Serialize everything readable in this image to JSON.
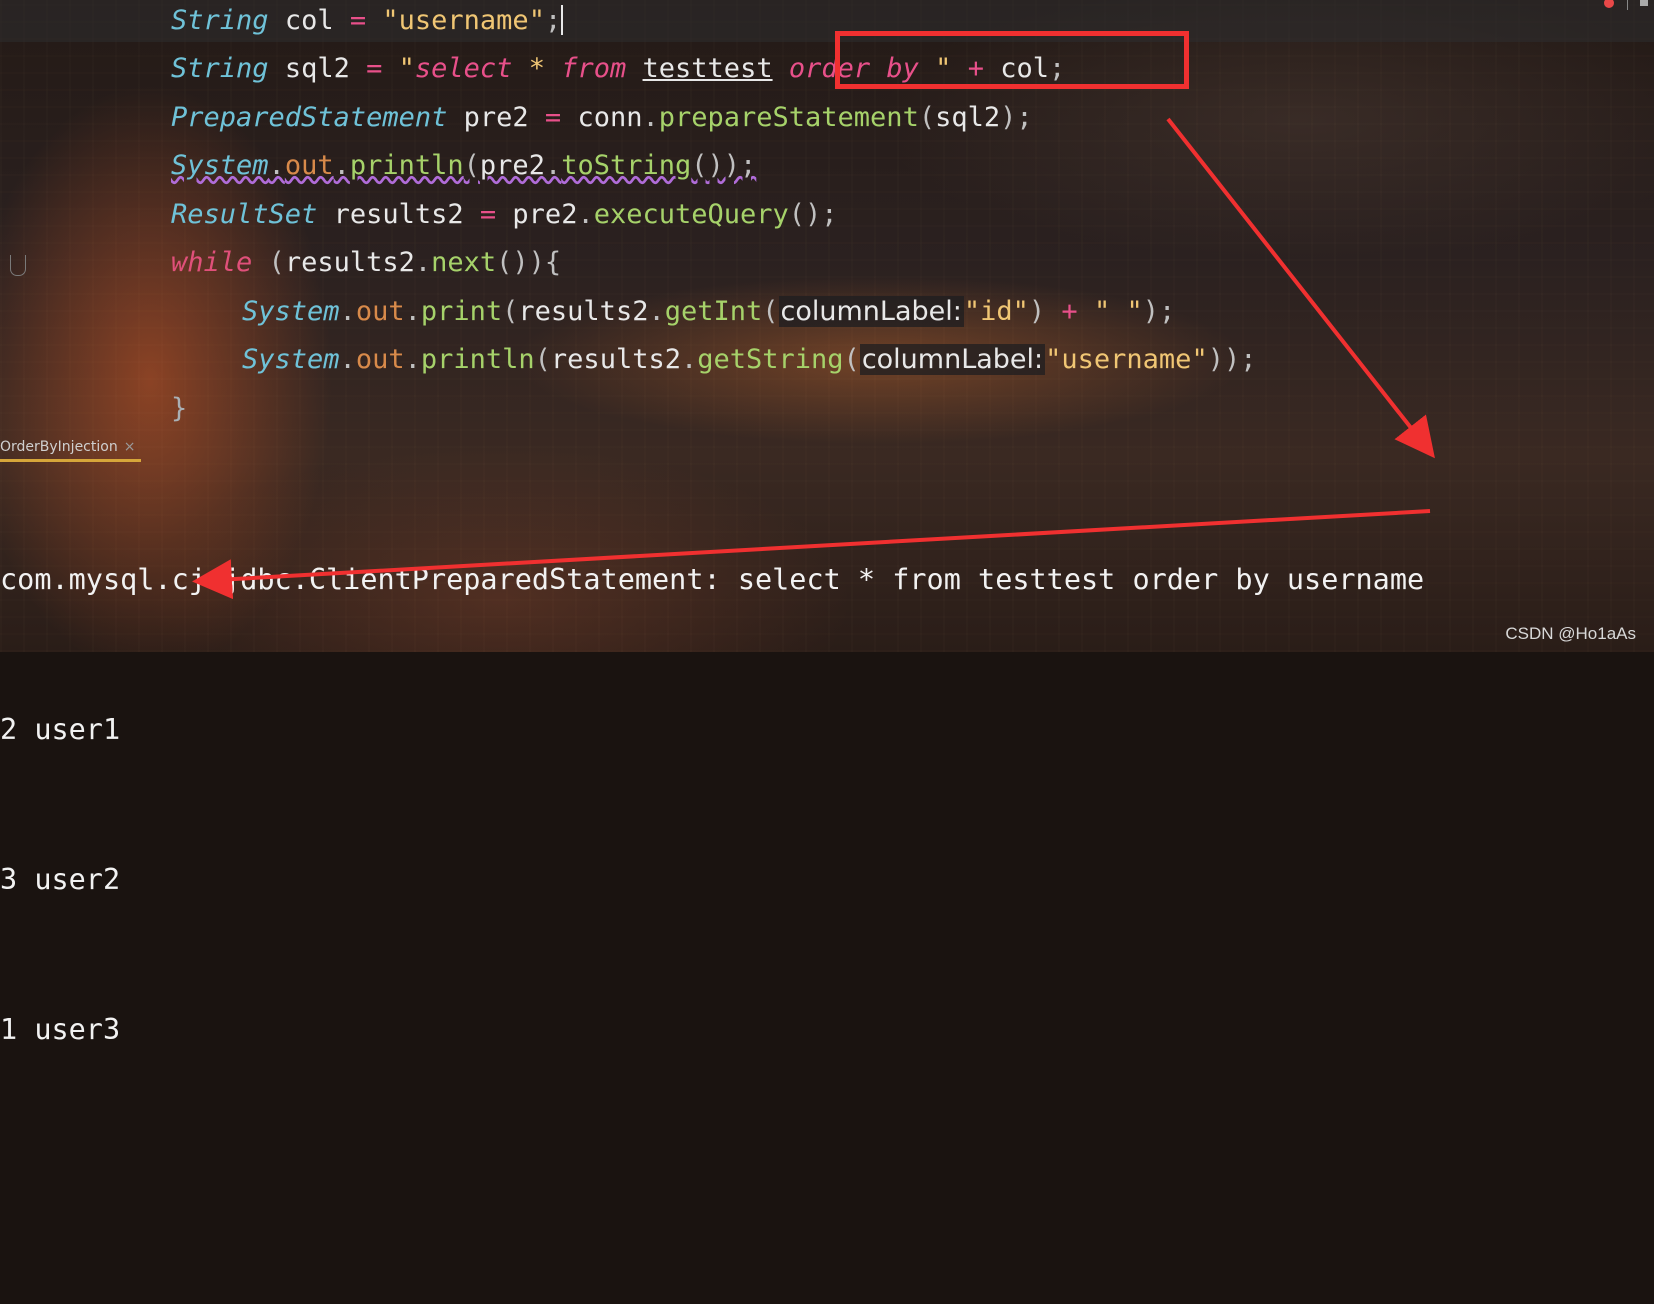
{
  "editor": {
    "line1": {
      "type": "String",
      "var": "col",
      "op": "=",
      "str": "\"username\"",
      "end": ";"
    },
    "line2": {
      "type": "String",
      "var": "sql2",
      "op": "=",
      "str_open": "\"",
      "sql_select": "select",
      "sql_star": " * ",
      "sql_from": "from",
      "sql_table": "testtest",
      "sql_order": "order",
      "sql_by": "by",
      "str_close": "\"",
      "plus": "+",
      "col": "col",
      "end": ";"
    },
    "line3": {
      "type": "PreparedStatement",
      "var": "pre2",
      "op": "=",
      "obj": "conn",
      "method": "prepareStatement",
      "arg": "sql2",
      "end": ");"
    },
    "line4": {
      "cls": "System",
      "field": "out",
      "method": "println",
      "obj": "pre2",
      "inner": "toString",
      "end": "());"
    },
    "line5": {
      "type": "ResultSet",
      "var": "results2",
      "op": "=",
      "obj": "pre2",
      "method": "executeQuery",
      "end": "();"
    },
    "line6": {
      "kw": "while",
      "obj": "results2",
      "method": "next",
      "end": "()){"
    },
    "line7": {
      "cls": "System",
      "field": "out",
      "method": "print",
      "obj": "results2",
      "inner": "getInt",
      "hint": "columnLabel:",
      "arg": "\"id\"",
      "plus": "+",
      "space": "\" \"",
      "end": ");"
    },
    "line8": {
      "cls": "System",
      "field": "out",
      "method": "println",
      "obj": "results2",
      "inner": "getString",
      "hint": "columnLabel:",
      "arg": "\"username\"",
      "end": "));"
    },
    "line9": {
      "brace": "}"
    }
  },
  "run_tab": {
    "label": "OrderByInjection",
    "close": "×"
  },
  "console": {
    "lines": [
      "com.mysql.cj.jdbc.ClientPreparedStatement: select * from testtest order by username",
      "2 user1",
      "3 user2",
      "1 user3"
    ]
  },
  "watermark": "CSDN @Ho1aAs",
  "colors": {
    "annotation_red": "#f03030",
    "type": "#6fc2d8",
    "keyword": "#e0507a",
    "string": "#f0c674",
    "method": "#a6d26a"
  }
}
